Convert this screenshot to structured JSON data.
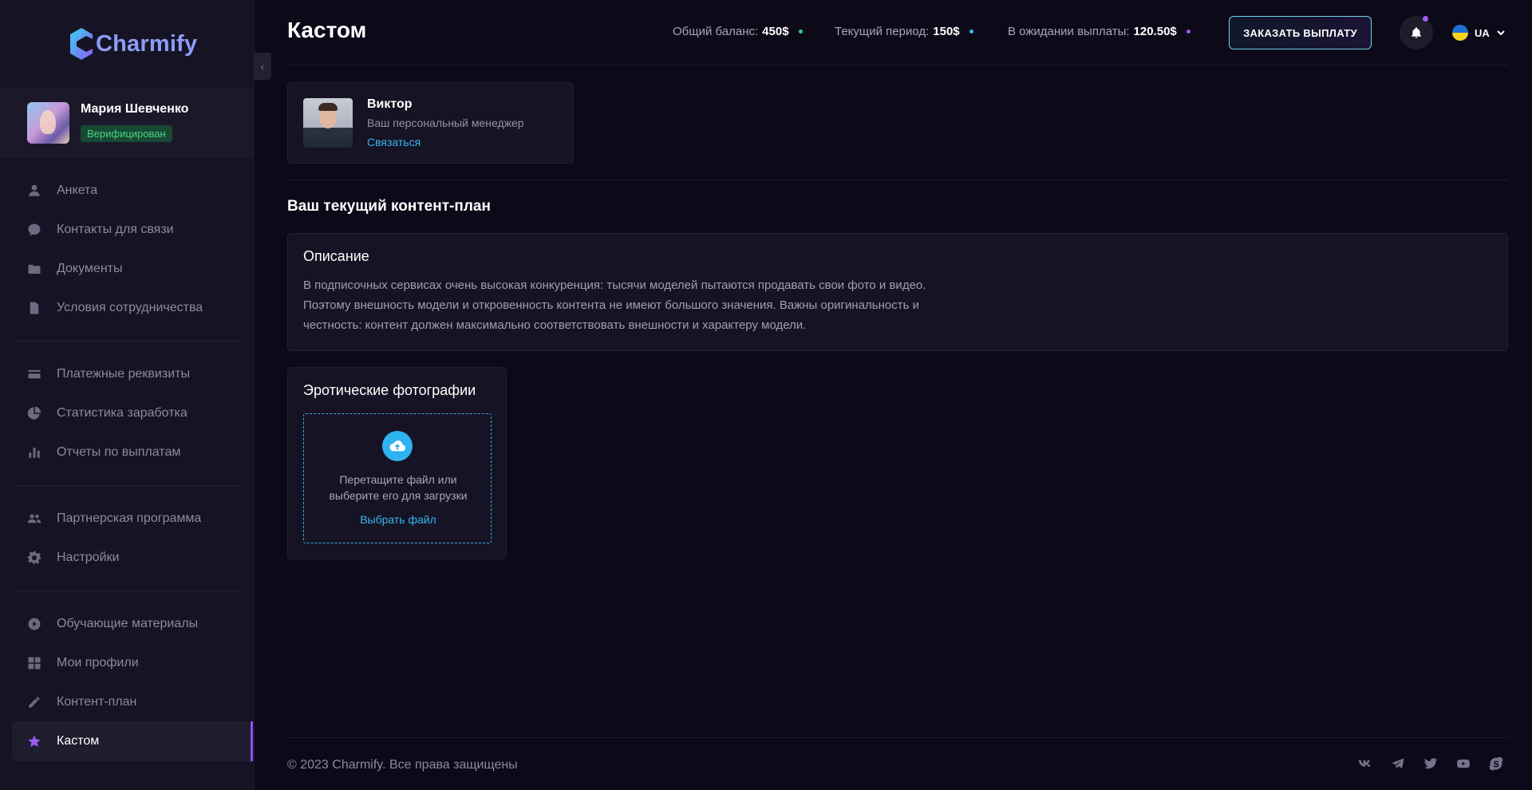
{
  "app": {
    "logo_text": "Charmify",
    "page_title": "Кастом"
  },
  "profile": {
    "name": "Мария Шевченко",
    "status": "Верифицирован"
  },
  "sidebar": {
    "items": [
      {
        "label": "Анкета",
        "icon": "user-icon"
      },
      {
        "label": "Контакты для связи",
        "icon": "chat-icon"
      },
      {
        "label": "Документы",
        "icon": "folder-icon"
      },
      {
        "label": "Условия сотрудничества",
        "icon": "document-icon"
      },
      {
        "label": "Платежные реквизиты",
        "icon": "card-icon"
      },
      {
        "label": "Статистика заработка",
        "icon": "pie-chart-icon"
      },
      {
        "label": "Отчеты по выплатам",
        "icon": "bar-chart-icon"
      },
      {
        "label": "Партнерская программа",
        "icon": "people-icon"
      },
      {
        "label": "Настройки",
        "icon": "gear-icon"
      },
      {
        "label": "Обучающие материалы",
        "icon": "play-icon"
      },
      {
        "label": "Мои профили",
        "icon": "grid-icon"
      },
      {
        "label": "Контент-план",
        "icon": "pencil-icon"
      },
      {
        "label": "Кастом",
        "icon": "star-icon",
        "active": true
      }
    ]
  },
  "header": {
    "total_balance_label": "Общий баланс:",
    "total_balance_value": "450$",
    "current_period_label": "Текущий период:",
    "current_period_value": "150$",
    "pending_label": "В ожидании выплаты:",
    "pending_value": "120.50$",
    "payout_button": "ЗАКАЗАТЬ ВЫПЛАТУ",
    "language": "UA",
    "colors": {
      "balance_dot": "#35d07f",
      "period_dot": "#35b9f0",
      "pending_dot": "#a25af5"
    }
  },
  "manager": {
    "name": "Виктор",
    "role": "Ваш персональный менеджер",
    "contact_link": "Связаться"
  },
  "content_plan": {
    "section_title": "Ваш текущий контент-план",
    "description_title": "Описание",
    "description_lines": [
      "В подписочных сервисах очень высокая конкуренция: тысячи моделей пытаются продавать свои фото и видео.",
      "Поэтому внешность модели и откровенность контента не имеют большого значения. Важны оригинальность и",
      "честность: контент должен максимально соответствовать внешности и характеру модели."
    ],
    "upload": {
      "title": "Эротические фотографии",
      "drop_line1": "Перетащите файл или",
      "drop_line2": "выберите его для загрузки",
      "choose_file": "Выбрать файл"
    }
  },
  "footer": {
    "copyright": "© 2023 Charmify. Все права защищены",
    "socials": [
      "vk-icon",
      "telegram-icon",
      "twitter-icon",
      "youtube-icon",
      "skype-icon"
    ]
  }
}
